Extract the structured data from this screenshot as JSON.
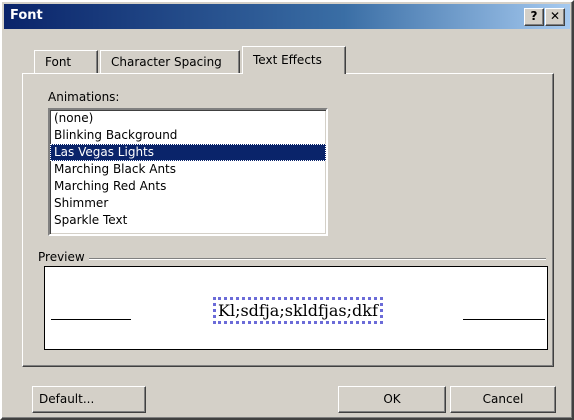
{
  "window": {
    "title": "Font",
    "help_label": "?",
    "close_label": "✕"
  },
  "tabs": [
    {
      "label": "Font",
      "active": false
    },
    {
      "label": "Character Spacing",
      "active": false
    },
    {
      "label": "Text Effects",
      "active": true
    }
  ],
  "animations": {
    "label": "Animations:",
    "selected": "Las Vegas Lights",
    "items": [
      "(none)",
      "Blinking Background",
      "Las Vegas Lights",
      "Marching Black Ants",
      "Marching Red Ants",
      "Shimmer",
      "Sparkle Text"
    ]
  },
  "preview": {
    "label": "Preview",
    "text": "Kl;sdfja;skldfjas;dkf"
  },
  "buttons": {
    "default": "Default...",
    "ok": "OK",
    "cancel": "Cancel"
  },
  "colors": {
    "title_bar": "#0a246a",
    "selection": "#0a246a",
    "face": "#d4d0c8",
    "marquee": "#6b6bd8"
  }
}
